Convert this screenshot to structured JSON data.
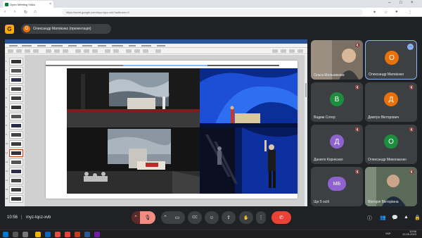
{
  "browser": {
    "tab_title": "Оpen Meeting Vidzo",
    "tab_close": "×",
    "url": "https://meet.google.com/myz-tqcz-xvb?authuser=0",
    "window_controls": [
      "–",
      "□",
      "×"
    ],
    "nav": [
      "‹",
      "›",
      "↻",
      "⌂"
    ]
  },
  "meet": {
    "logo_letter": "G",
    "presenter_chip": {
      "avatar_letter": "О",
      "label": "Олександр Матвієнко (презентація)"
    },
    "time": "10:56",
    "separator": "|",
    "meeting_code": "myz-tqcz-xvb"
  },
  "participants": [
    {
      "name": "Ольга Мельникова",
      "avatar": "",
      "video": true,
      "color": "#5f6368"
    },
    {
      "name": "Олександр Матвієнко",
      "avatar": "О",
      "video": false,
      "color": "#e8710a",
      "active": true
    },
    {
      "name": "Вадим Сотер",
      "avatar": "В",
      "video": false,
      "color": "#1e8e3e"
    },
    {
      "name": "Дмитро Вікторович",
      "avatar": "Д",
      "video": false,
      "color": "#e8710a"
    },
    {
      "name": "Данило Корнієнко",
      "avatar": "Д",
      "video": false,
      "color": "#8e63ce"
    },
    {
      "name": "Олександр Миколаєнко",
      "avatar": "О",
      "video": false,
      "color": "#1e8e3e"
    },
    {
      "name": "Ще 5 осіб",
      "avatar": "МБ",
      "video": false,
      "color": "#8e63ce"
    },
    {
      "name": "Вікторія Вікторівна",
      "avatar": "",
      "video": true,
      "color": "#5f6368"
    }
  ],
  "controls": {
    "chevron": "⌃",
    "mic": "🎙",
    "camera": "▭",
    "captions": "CC",
    "emoji": "☺",
    "present": "⇪",
    "hand": "✋",
    "more": "⋮",
    "leave": "✆",
    "info": "ⓘ",
    "people": "👥",
    "chat": "💬",
    "activities": "▲",
    "host": "🔒"
  },
  "taskbar": {
    "lang": "УКР",
    "time": "10:56",
    "date": "12.05.2023"
  },
  "ppt": {
    "slide_numbers": [
      "1",
      "2",
      "3",
      "4",
      "5",
      "6",
      "7",
      "8",
      "9",
      "10",
      "11",
      "12",
      "13",
      "14",
      "15",
      "16"
    ]
  }
}
